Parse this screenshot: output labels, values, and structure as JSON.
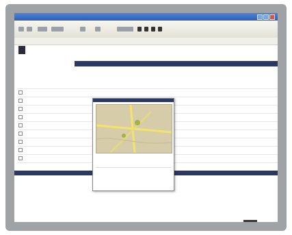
{
  "colors": {
    "bezel": "#9fa3a6",
    "titlebar": "#2d5fb8",
    "navbar": "#2a3866",
    "toolbar": "#e4e2d8",
    "map_bg": "#d7ccaa",
    "map_road": "#f2e46a"
  },
  "window": {
    "title": ""
  },
  "toolbar": {
    "back_icon": "back-arrow-icon",
    "forward_icon": "forward-arrow-icon",
    "items": [
      "",
      "",
      "",
      ""
    ]
  },
  "header": {
    "logo_text": "",
    "top_right_text": "",
    "left_label": "",
    "right_link": ""
  },
  "main": {
    "section_title": ""
  },
  "table": {
    "rows": 9,
    "columns": 6
  },
  "pager": {
    "text": ""
  },
  "popup": {
    "label": "",
    "footer": ""
  }
}
